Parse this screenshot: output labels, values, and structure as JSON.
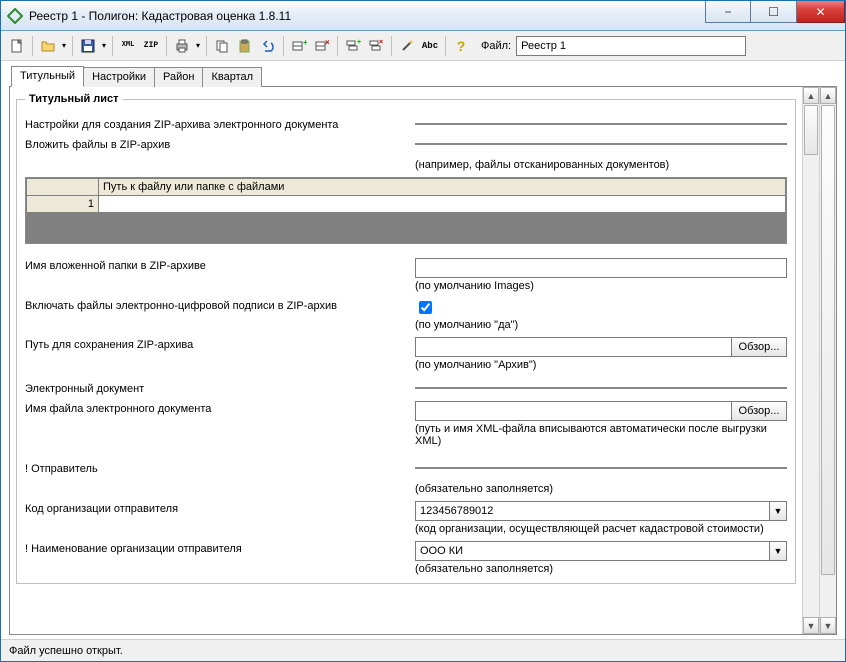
{
  "window": {
    "title": "Реестр 1 - Полигон: Кадастровая оценка 1.8.11"
  },
  "win_controls": {
    "min": "−",
    "max": "☐",
    "close": "✕"
  },
  "toolbar": {
    "file_label": "Файл:",
    "file_value": "Реестр 1",
    "btn_xml_label": "XML",
    "btn_zip_label": "ZIP",
    "btn_abc_label": "Abc",
    "tooltip_new": "Создать",
    "tooltip_open": "Открыть",
    "tooltip_save": "Сохранить",
    "tooltip_print": "Печать",
    "tooltip_copy": "Копировать",
    "tooltip_paste": "Вставить",
    "tooltip_undo": "Отменить",
    "tooltip_help": "Справка"
  },
  "tabs": {
    "t1": "Титульный",
    "t2": "Настройки",
    "t3": "Район",
    "t4": "Квартал"
  },
  "fieldset": {
    "legend": "Титульный лист"
  },
  "form": {
    "zip_settings_label": "Настройки для создания ZIP-архива электронного документа",
    "include_files_label": "Вложить файлы в ZIP-архив",
    "include_files_hint": "(например, файлы отсканированных документов)",
    "grid_header_path": "Путь к файлу или папке с файлами",
    "grid_row1_num": "1",
    "nested_folder_label": "Имя вложенной папки в ZIP-архиве",
    "nested_folder_hint": "(по умолчанию Images)",
    "include_sig_label": "Включать файлы электронно-цифровой подписи в ZIP-архив",
    "include_sig_checked": true,
    "include_sig_hint": "(по умолчанию \"да\")",
    "save_path_label": "Путь для сохранения ZIP-архива",
    "browse_label": "Обзор...",
    "save_path_hint": "(по умолчанию \"Архив\")",
    "edoc_section": "Электронный документ",
    "edoc_name_label": "Имя файла электронного документа",
    "edoc_name_hint": "(путь и имя XML-файла вписываются автоматически после выгрузки XML)",
    "sender_section": "! Отправитель",
    "sender_hint": "(обязательно заполняется)",
    "org_code_label": "Код организации отправителя",
    "org_code_value": "123456789012",
    "org_code_hint": "(код организации, осуществляющей расчет кадастровой стоимости)",
    "org_name_label": "! Наименование организации отправителя",
    "org_name_value": "ООО КИ",
    "org_name_hint": "(обязательно заполняется)"
  },
  "status": {
    "text": "Файл успешно открыт."
  }
}
